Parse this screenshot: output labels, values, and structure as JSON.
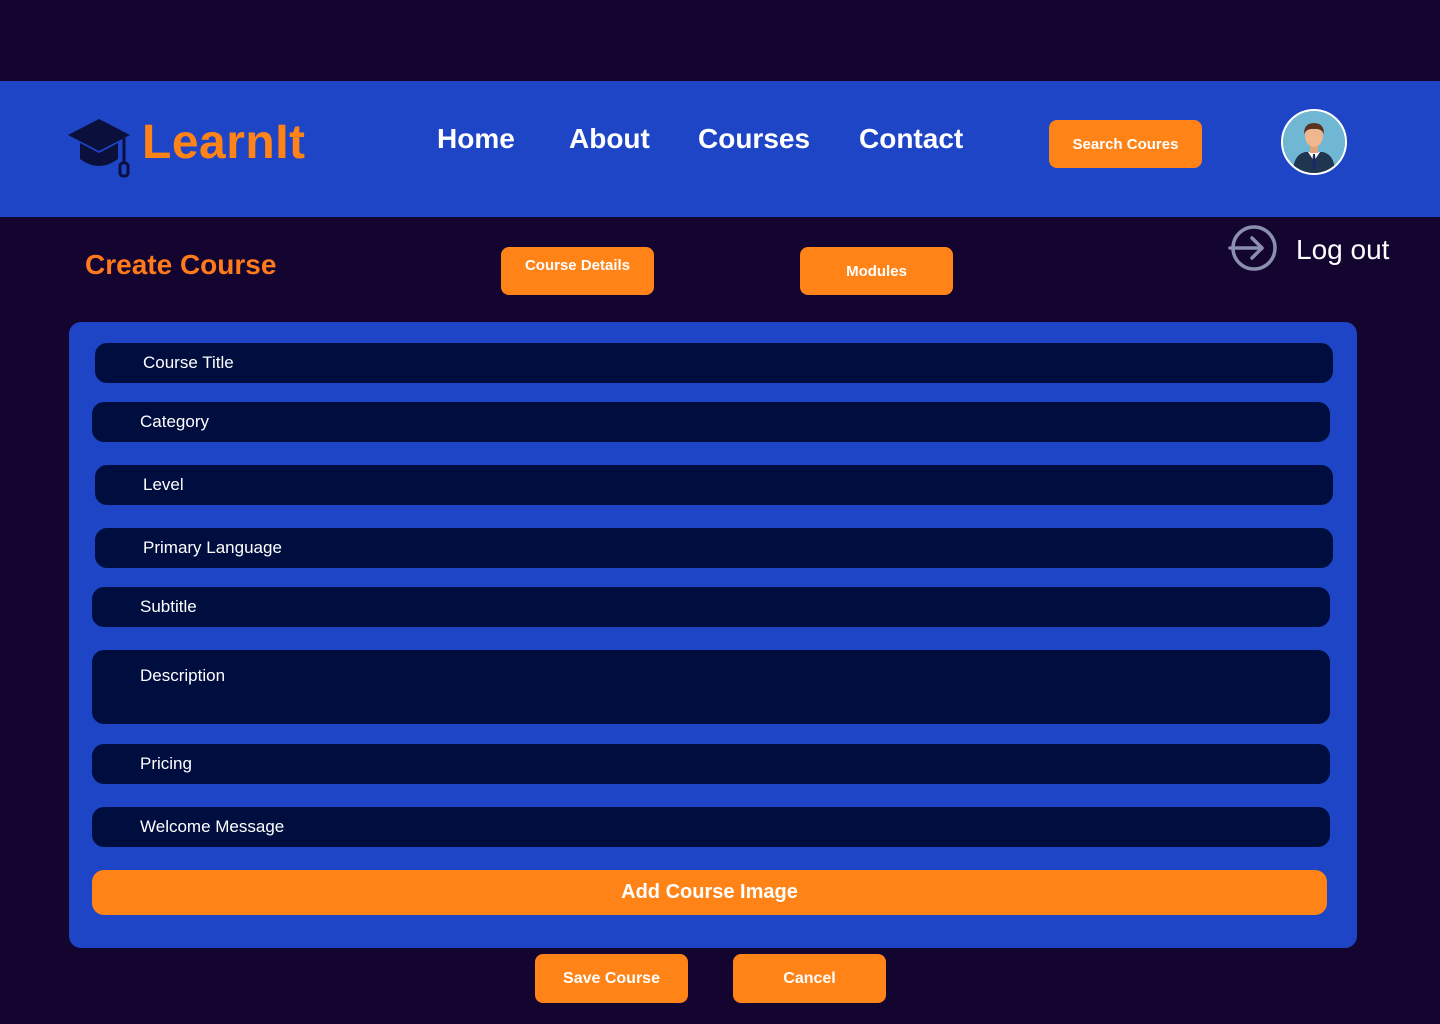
{
  "brand": {
    "name": "LearnIt",
    "icon": "graduation-cap-icon",
    "color": "#ff8317"
  },
  "nav": {
    "home": "Home",
    "about": "About",
    "courses": "Courses",
    "contact": "Contact",
    "search_button": "Search Coures"
  },
  "user": {
    "avatar": "user-avatar",
    "logout_label": "Log out",
    "logout_icon": "log-in-arrow-icon"
  },
  "page": {
    "title": "Create Course",
    "tabs": {
      "course_details": "Course Details",
      "modules": "Modules"
    }
  },
  "form": {
    "course_title": "Course Title",
    "category": "Category",
    "level": "Level",
    "primary_language": "Primary Language",
    "subtitle": "Subtitle",
    "description": "Description",
    "pricing": "Pricing",
    "welcome_message": "Welcome Message",
    "add_image_button": "Add Course Image"
  },
  "actions": {
    "save": "Save Course",
    "cancel": "Cancel"
  },
  "colors": {
    "background": "#140430",
    "header": "#1e45c6",
    "accent": "#ff8317",
    "field": "#000e3f"
  }
}
